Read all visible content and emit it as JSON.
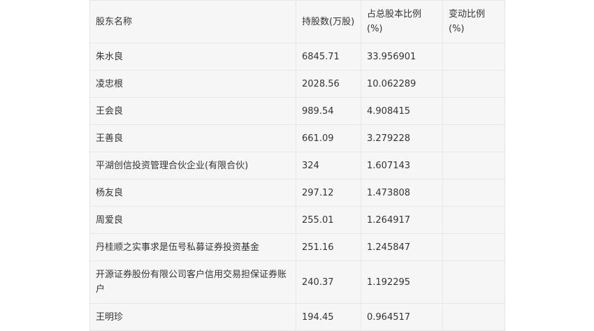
{
  "table": {
    "headers": [
      "股东名称",
      "持股数(万股)",
      "占总股本比例(%)",
      "变动比例(%)"
    ],
    "rows": [
      {
        "name": "朱水良",
        "shares": "6845.71",
        "ratio": "33.956901",
        "change": ""
      },
      {
        "name": "凌忠根",
        "shares": "2028.56",
        "ratio": "10.062289",
        "change": ""
      },
      {
        "name": "王会良",
        "shares": "989.54",
        "ratio": "4.908415",
        "change": ""
      },
      {
        "name": "王善良",
        "shares": "661.09",
        "ratio": "3.279228",
        "change": ""
      },
      {
        "name": "平湖创信投资管理合伙企业(有限合伙)",
        "shares": "324",
        "ratio": "1.607143",
        "change": ""
      },
      {
        "name": "杨友良",
        "shares": "297.12",
        "ratio": "1.473808",
        "change": ""
      },
      {
        "name": "周爱良",
        "shares": "255.01",
        "ratio": "1.264917",
        "change": ""
      },
      {
        "name": "丹桂顺之实事求是伍号私募证券投资基金",
        "shares": "251.16",
        "ratio": "1.245847",
        "change": ""
      },
      {
        "name": "开源证券股份有限公司客户信用交易担保证券账户",
        "shares": "240.37",
        "ratio": "1.192295",
        "change": ""
      },
      {
        "name": "王明珍",
        "shares": "194.45",
        "ratio": "0.964517",
        "change": ""
      }
    ]
  }
}
